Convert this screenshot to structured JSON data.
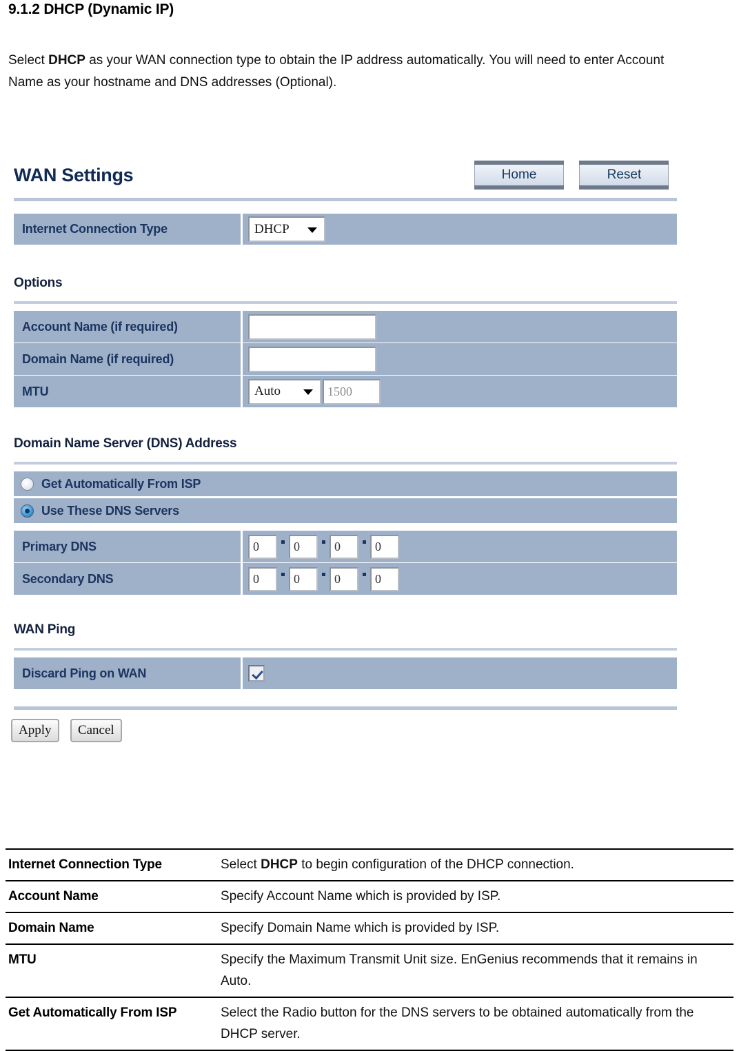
{
  "document": {
    "heading": "9.1.2 DHCP (Dynamic IP)",
    "paragraph_before": "Select ",
    "paragraph_bold": "DHCP",
    "paragraph_after": " as your WAN connection type to obtain the IP address automatically. You will need to enter Account Name as your hostname and DNS addresses (Optional)."
  },
  "panel": {
    "title": "WAN Settings",
    "buttons": {
      "home": "Home",
      "reset": "Reset"
    },
    "connection_row": {
      "label": "Internet Connection Type",
      "select_value": "DHCP"
    },
    "options": {
      "heading": "Options",
      "account_name": {
        "label": "Account Name (if required)",
        "value": "",
        "placeholder": ""
      },
      "domain_name": {
        "label": "Domain Name (if required)",
        "value": "",
        "placeholder": ""
      },
      "mtu": {
        "label": "MTU",
        "select_value": "Auto",
        "size_value": "1500"
      }
    },
    "dns": {
      "heading": "Domain Name Server (DNS) Address",
      "option_auto": {
        "label": "Get Automatically From ISP",
        "selected": false
      },
      "option_manual": {
        "label": "Use These DNS Servers",
        "selected": true
      },
      "primary": {
        "label": "Primary DNS",
        "octets": [
          "0",
          "0",
          "0",
          "0"
        ]
      },
      "secondary": {
        "label": "Secondary DNS",
        "octets": [
          "0",
          "0",
          "0",
          "0"
        ]
      },
      "separator": "."
    },
    "wan_ping": {
      "heading": "WAN Ping",
      "discard": {
        "label": "Discard Ping on WAN",
        "checked": true
      }
    },
    "actions": {
      "apply": "Apply",
      "cancel": "Cancel"
    }
  },
  "reference_table": {
    "rows": [
      {
        "term": "Internet Connection Type",
        "desc_before": "Select ",
        "desc_bold": "DHCP",
        "desc_after": " to begin configuration of the DHCP connection."
      },
      {
        "term": "Account Name",
        "desc_before": "Specify Account Name which is provided by ISP.",
        "desc_bold": "",
        "desc_after": ""
      },
      {
        "term": "Domain Name",
        "desc_before": "Specify Domain Name which is provided by ISP.",
        "desc_bold": "",
        "desc_after": ""
      },
      {
        "term": "MTU",
        "desc_before": "Specify the Maximum Transmit Unit size. EnGenius recommends that it remains in Auto.",
        "desc_bold": "",
        "desc_after": ""
      },
      {
        "term": "Get Automatically From ISP",
        "desc_before": "Select the Radio button for the DNS servers to be obtained automatically from the DHCP server.",
        "desc_bold": "",
        "desc_after": ""
      }
    ]
  },
  "colors": {
    "row_background": "#9fb0c9",
    "label_text": "#1b3560",
    "panel_title": "#102a54",
    "rule": "#b8c4d8"
  }
}
